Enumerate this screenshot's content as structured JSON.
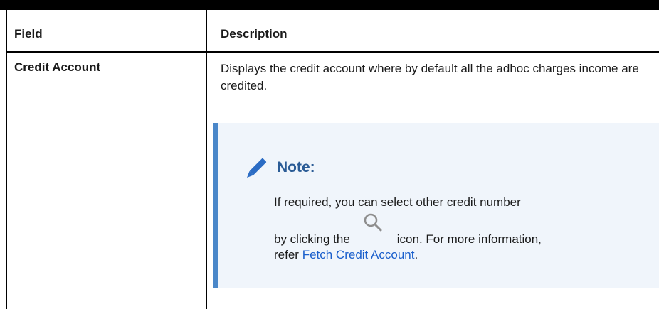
{
  "table": {
    "headers": {
      "field": "Field",
      "description": "Description"
    },
    "rows": [
      {
        "field": "Credit Account",
        "description": "Displays the credit account where by default all the adhoc charges income are credited.",
        "note": {
          "title": "Note:",
          "paragraph1": "If required, you can select other credit number",
          "paragraph2_before_icon": "by clicking the",
          "paragraph2_after_icon": "icon. For more information,",
          "paragraph2_line2_prefix": "refer ",
          "link_text": "Fetch Credit Account",
          "paragraph2_line2_suffix": "."
        }
      }
    ]
  },
  "colors": {
    "note_accent": "#4a87c9",
    "note_background": "#f0f5fb",
    "note_title": "#2b5c96",
    "link": "#1a5fcc"
  },
  "icons": {
    "note": "pencil-icon",
    "inline": "search-icon"
  }
}
